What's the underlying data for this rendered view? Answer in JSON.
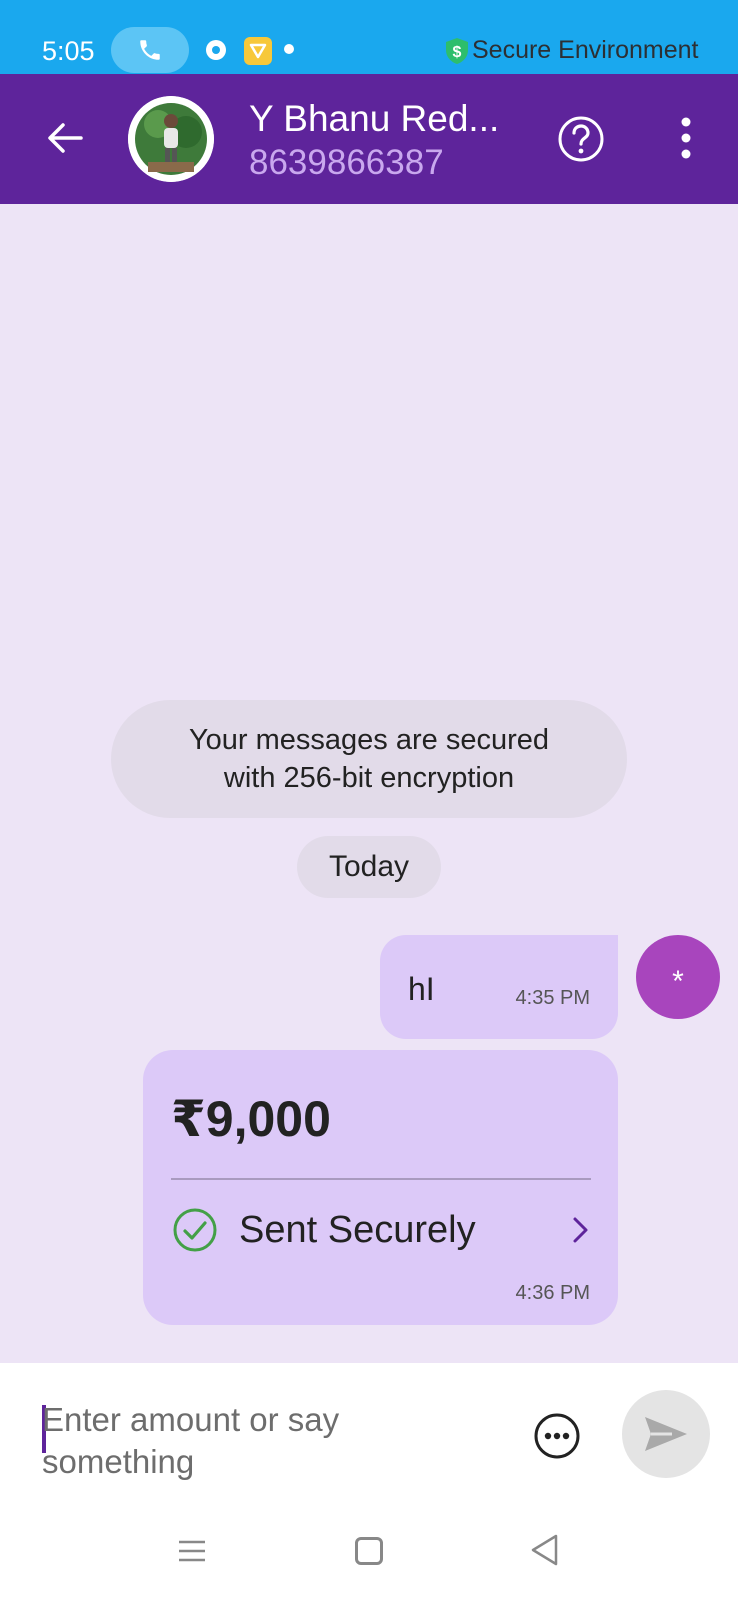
{
  "status_bar": {
    "time": "5:05",
    "secure_label": "Secure Environment"
  },
  "header": {
    "contact_name": "Y Bhanu Red...",
    "contact_phone": "8639866387"
  },
  "chat": {
    "encryption_notice": [
      "Your messages are secured",
      "with 256-bit encryption"
    ],
    "date_chip": "Today",
    "message": {
      "text": "hI",
      "time": "4:35 PM"
    },
    "sender_avatar": "*",
    "payment": {
      "amount": "₹9,000",
      "status": "Sent Securely",
      "time": "4:36 PM"
    }
  },
  "composer": {
    "placeholder": "Enter amount or say something"
  },
  "colors": {
    "status_bar": "#1aa8ee",
    "header": "#5e249b",
    "chat_bg": "#ede4f6",
    "bubble": "#dcc9f8",
    "avatar": "#a845bd",
    "success": "#43a047"
  }
}
